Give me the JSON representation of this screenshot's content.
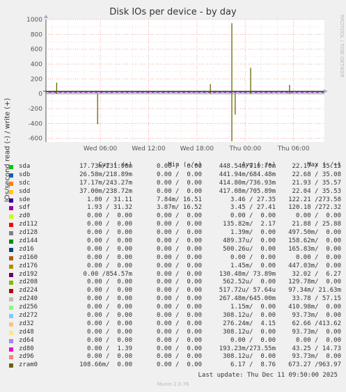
{
  "title": "Disk IOs per device - by day",
  "ylabel": "IOs/second read (-) / write (+)",
  "watermark": "RRDTOOL / TOBI OETIKER",
  "footer": "Munin 2.0.76",
  "last_update": "Last update: Thu Dec 11 09:50:00 2025",
  "headers": {
    "cur": "Cur (-/+)",
    "min": "Min (-/+)",
    "avg": "Avg (-/+)",
    "max": "Max (-/+)"
  },
  "chart_data": {
    "type": "line",
    "title": "Disk IOs per device - by day",
    "xlabel": "",
    "ylabel": "IOs/second read (-) / write (+)",
    "ylim": [
      -650,
      1000
    ],
    "yticks": [
      -600,
      -400,
      -200,
      0,
      200,
      400,
      600,
      800,
      1000
    ],
    "xticks": [
      "Wed 06:00",
      "Wed 12:00",
      "Wed 18:00",
      "Thu 00:00",
      "Thu 06:00"
    ],
    "grid": true,
    "spikes": [
      {
        "x": "Wed 00:35",
        "y": 150
      },
      {
        "x": "Wed 05:40",
        "y": -410
      },
      {
        "x": "Wed 19:40",
        "y": 130
      },
      {
        "x": "Wed 22:20",
        "y": -640
      },
      {
        "x": "Wed 22:20",
        "y": 950
      },
      {
        "x": "Wed 22:45",
        "y": -280
      },
      {
        "x": "Thu 00:40",
        "y": 350
      },
      {
        "x": "Thu 05:30",
        "y": 120
      }
    ],
    "series": [
      {
        "name": "sda",
        "color": "#00cc00",
        "cur": "17.73m/231.96m",
        "min": "0.00 /  0.00",
        "avg": "448.54m/710.70m",
        "max": "22.17 / 35.15"
      },
      {
        "name": "sdb",
        "color": "#0066b3",
        "cur": "26.58m/218.89m",
        "min": "0.00 /  0.00",
        "avg": "441.94m/684.48m",
        "max": "22.68 / 35.08"
      },
      {
        "name": "sdc",
        "color": "#ff8000",
        "cur": "17.17m/243.27m",
        "min": "0.00 /  0.00",
        "avg": "414.80m/736.93m",
        "max": "21.93 / 35.57"
      },
      {
        "name": "sdd",
        "color": "#ffcc00",
        "cur": "37.00m/238.72m",
        "min": "0.00 /  0.00",
        "avg": "417.08m/705.89m",
        "max": "22.04 / 35.53"
      },
      {
        "name": "sde",
        "color": "#330099",
        "cur": " 1.80 / 31.11",
        "min": "7.84m/ 16.51",
        "avg": " 3.46 / 27.35",
        "max": "122.21 /273.58"
      },
      {
        "name": "sdf",
        "color": "#990099",
        "cur": " 1.93 / 31.32",
        "min": "3.87m/ 16.52",
        "avg": " 3.45 / 27.41",
        "max": "120.18 /272.32"
      },
      {
        "name": "zd0",
        "color": "#ccff00",
        "cur": " 0.00 /  0.00",
        "min": "0.00 /  0.00",
        "avg": " 0.00 /  0.00",
        "max": " 0.00 /  0.00"
      },
      {
        "name": "zd112",
        "color": "#ff0000",
        "cur": " 0.00 /  0.00",
        "min": "0.00 /  0.00",
        "avg": "135.82m/  2.17",
        "max": "21.88 / 25.88"
      },
      {
        "name": "zd128",
        "color": "#808080",
        "cur": " 0.00 /  0.00",
        "min": "0.00 /  0.00",
        "avg": " 1.39m/  0.00",
        "max": "497.50m/  0.00"
      },
      {
        "name": "zd144",
        "color": "#008f00",
        "cur": " 0.00 /  0.00",
        "min": "0.00 /  0.00",
        "avg": "489.37u/  0.00",
        "max": "158.62m/  0.00"
      },
      {
        "name": "zd16",
        "color": "#00487d",
        "cur": " 0.00 /  0.00",
        "min": "0.00 /  0.00",
        "avg": "500.26u/  0.00",
        "max": "165.83m/  0.00"
      },
      {
        "name": "zd160",
        "color": "#b35a00",
        "cur": " 0.00 /  0.00",
        "min": "0.00 /  0.00",
        "avg": " 0.00 /  0.00",
        "max": " 0.00 /  0.00"
      },
      {
        "name": "zd176",
        "color": "#b38f00",
        "cur": " 0.00 /  0.00",
        "min": "0.00 /  0.00",
        "avg": " 1.45m/  0.00",
        "max": "447.03m/  0.00"
      },
      {
        "name": "zd192",
        "color": "#6b006b",
        "cur": " 0.00 /854.57m",
        "min": "0.00 /  0.00",
        "avg": "130.48m/ 73.89m",
        "max": "32.02 /  6.27"
      },
      {
        "name": "zd208",
        "color": "#8fb300",
        "cur": " 0.00 /  0.00",
        "min": "0.00 /  0.00",
        "avg": "562.52u/  0.00",
        "max": "129.78m/  0.00"
      },
      {
        "name": "zd224",
        "color": "#b30000",
        "cur": " 0.00 /  0.00",
        "min": "0.00 /  0.00",
        "avg": "517.72u/ 57.64u",
        "max": "97.34m/ 21.63m"
      },
      {
        "name": "zd240",
        "color": "#bebebe",
        "cur": " 0.00 /  0.00",
        "min": "0.00 /  0.00",
        "avg": "267.48m/645.00m",
        "max": "33.78 / 57.15"
      },
      {
        "name": "zd256",
        "color": "#80ff80",
        "cur": " 0.00 /  0.00",
        "min": "0.00 /  0.00",
        "avg": " 1.15m/  0.00",
        "max": "410.98m/  0.00"
      },
      {
        "name": "zd272",
        "color": "#80c9ff",
        "cur": " 0.00 /  0.00",
        "min": "0.00 /  0.00",
        "avg": "308.12u/  0.00",
        "max": "93.73m/  0.00"
      },
      {
        "name": "zd32",
        "color": "#ffc080",
        "cur": " 0.00 /  0.00",
        "min": "0.00 /  0.00",
        "avg": "276.24m/  4.15",
        "max": "62.66 /413.62"
      },
      {
        "name": "zd48",
        "color": "#ffe680",
        "cur": " 0.00 /  0.00",
        "min": "0.00 /  0.00",
        "avg": "308.12u/  0.00",
        "max": "93.73m/  0.00"
      },
      {
        "name": "zd64",
        "color": "#aa80ff",
        "cur": " 0.00 /  0.00",
        "min": "0.00 /  0.00",
        "avg": " 0.00 /  0.00",
        "max": " 0.00 /  0.00"
      },
      {
        "name": "zd80",
        "color": "#ee00cc",
        "cur": " 0.00 /  1.39",
        "min": "0.00 /  0.00",
        "avg": "193.23m/273.55m",
        "max": "43.25 / 14.73"
      },
      {
        "name": "zd96",
        "color": "#ff8080",
        "cur": " 0.00 /  0.00",
        "min": "0.00 /  0.00",
        "avg": "308.12u/  0.00",
        "max": "93.73m/  0.00"
      },
      {
        "name": "zram0",
        "color": "#666600",
        "cur": "108.66m/  0.00",
        "min": "0.00 /  0.00",
        "avg": " 6.17 /  8.76",
        "max": "673.27 /963.97"
      }
    ]
  }
}
